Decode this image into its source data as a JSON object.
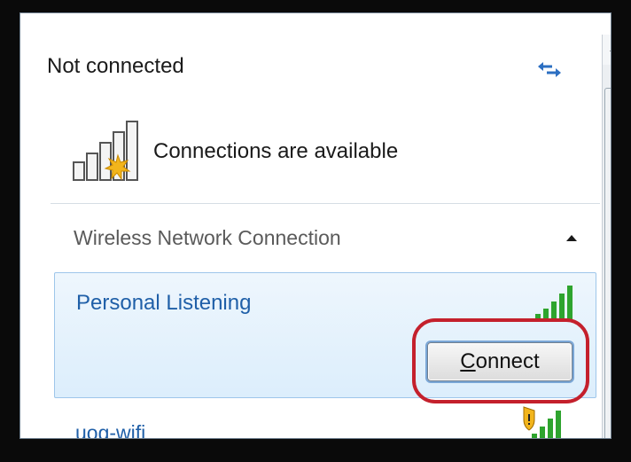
{
  "header": {
    "title": "Not connected"
  },
  "status": {
    "text": "Connections are available",
    "icon": "signal-bars-starburst-icon"
  },
  "section": {
    "title": "Wireless Network Connection"
  },
  "networks": [
    {
      "name": "Personal Listening",
      "signal_icon": "signal-strength-icon",
      "selected": true,
      "button_label_prefix": "",
      "button_label_access": "C",
      "button_label_rest": "onnect"
    },
    {
      "name": "uog-wifi",
      "signal_icon": "signal-strength-shield-icon",
      "selected": false
    }
  ],
  "colors": {
    "link_blue": "#1f5fa8",
    "highlight_red": "#c4202c",
    "selection_bg": "#dceefc"
  }
}
